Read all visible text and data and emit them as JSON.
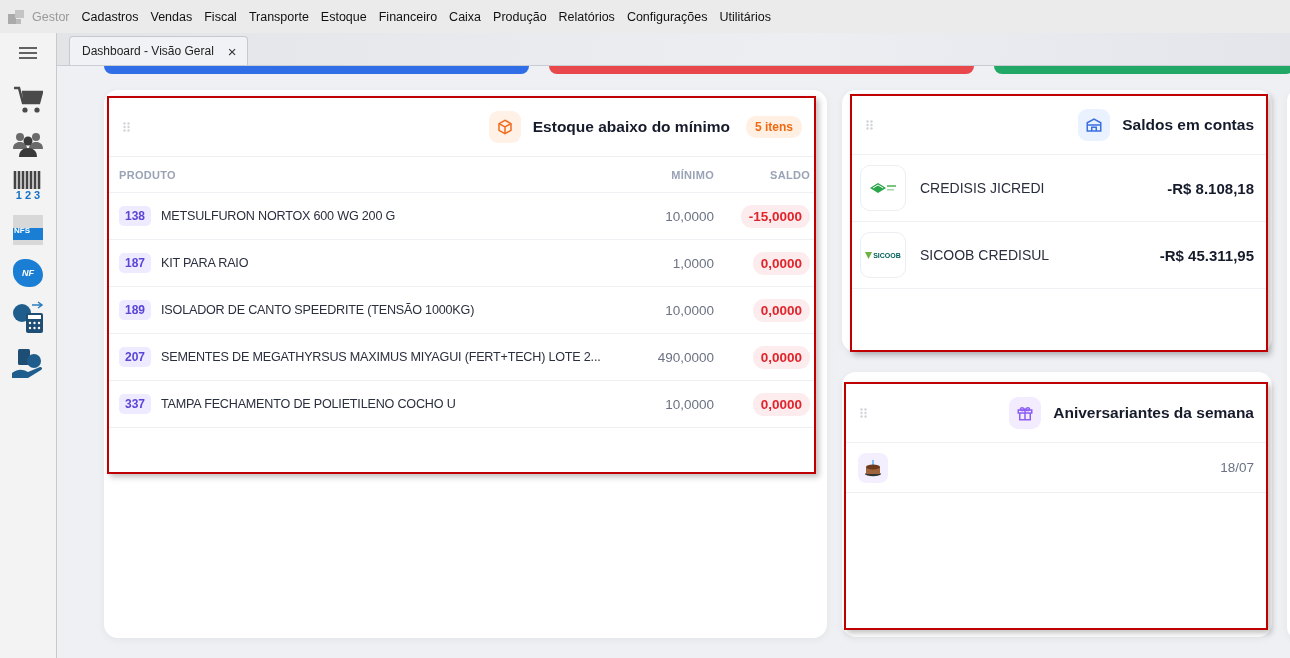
{
  "menu": {
    "app": "Gestor",
    "items": [
      "Cadastros",
      "Vendas",
      "Fiscal",
      "Transporte",
      "Estoque",
      "Financeiro",
      "Caixa",
      "Produção",
      "Relatórios",
      "Configurações",
      "Utilitários"
    ]
  },
  "sidebar": {
    "items": [
      {
        "kind": "cart"
      },
      {
        "kind": "people"
      },
      {
        "kind": "barcode",
        "label": "1 2 3"
      },
      {
        "kind": "nfse",
        "label": "NFS"
      },
      {
        "kind": "nfe",
        "label": "NF"
      },
      {
        "kind": "calculator"
      },
      {
        "kind": "money-hand"
      }
    ]
  },
  "tabs": [
    {
      "label": "Dashboard - Visão Geral",
      "selected": true,
      "close": "×"
    }
  ],
  "stock_widget": {
    "title": "Estoque abaixo do mínimo",
    "badge": "5 itens",
    "columns": [
      "PRODUTO",
      "MÍNIMO",
      "SALDO"
    ],
    "rows": [
      {
        "code": "138",
        "product": "METSULFURON NORTOX 600 WG 200 G",
        "minimum": "10,0000",
        "balance": "-15,0000"
      },
      {
        "code": "187",
        "product": "KIT PARA RAIO",
        "minimum": "1,0000",
        "balance": "0,0000"
      },
      {
        "code": "189",
        "product": "ISOLADOR DE CANTO SPEEDRITE (TENSÃO 1000KG)",
        "minimum": "10,0000",
        "balance": "0,0000"
      },
      {
        "code": "207",
        "product": "SEMENTES DE MEGATHYRSUS MAXIMUS MIYAGUI (FERT+TECH) LOTE 2...",
        "minimum": "490,0000",
        "balance": "0,0000"
      },
      {
        "code": "337",
        "product": "TAMPA FECHAMENTO DE POLIETILENO COCHO U",
        "minimum": "10,0000",
        "balance": "0,0000"
      }
    ]
  },
  "accounts_widget": {
    "title": "Saldos em contas",
    "rows": [
      {
        "kind": "leaf",
        "name": "CREDISIS JICREDI",
        "balance": "-R$ 8.108,18"
      },
      {
        "kind": "sicoob",
        "logo_text": "SICOOB",
        "name": "SICOOB CREDISUL",
        "balance": "-R$ 45.311,95"
      }
    ]
  },
  "birthdays_widget": {
    "title": "Aniversariantes da semana",
    "rows": [
      {
        "date": "18/07"
      }
    ]
  }
}
